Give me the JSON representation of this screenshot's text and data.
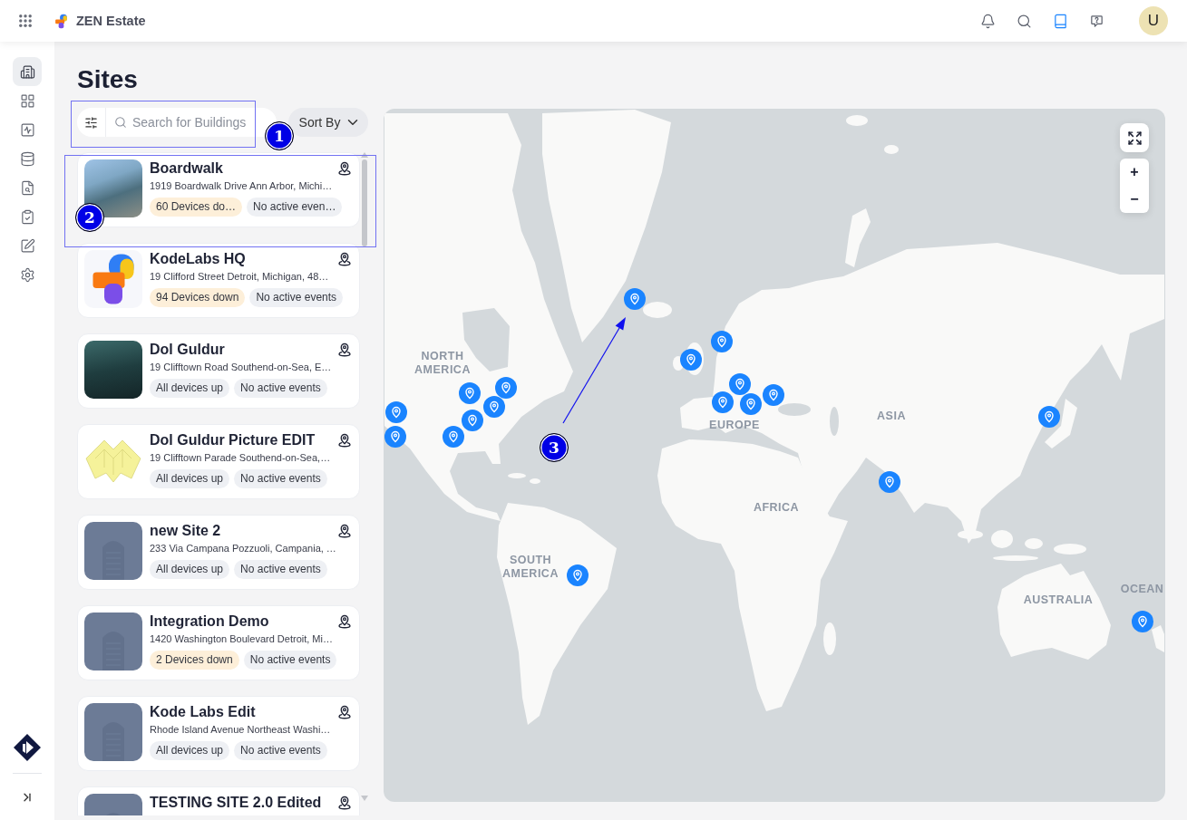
{
  "top_bar": {
    "brand": "ZEN Estate",
    "actions": [
      {
        "kind": "notifications",
        "selected": false
      },
      {
        "kind": "search",
        "selected": false
      },
      {
        "kind": "docs",
        "selected": true
      },
      {
        "kind": "help",
        "selected": false
      }
    ],
    "avatar": "U"
  },
  "nav": {
    "items": [
      {
        "kind": "buildings",
        "selected": true
      },
      {
        "kind": "apps",
        "selected": false
      },
      {
        "kind": "analytics",
        "selected": false
      },
      {
        "kind": "data",
        "selected": false
      },
      {
        "kind": "insights",
        "selected": false
      },
      {
        "kind": "tasks",
        "selected": false
      },
      {
        "kind": "edit",
        "selected": false
      },
      {
        "kind": "settings",
        "selected": false
      }
    ]
  },
  "page": {
    "title": "Sites"
  },
  "toolbar": {
    "search": {
      "placeholder": "Search for Buildings"
    },
    "sort": {
      "label": "Sort By"
    }
  },
  "sites": [
    {
      "kind": "photo",
      "name": "Boardwalk",
      "address": "1919 Boardwalk Drive Ann Arbor, Michi…",
      "devices": "60 Devices do…",
      "devices_down": true,
      "events": "No active even…"
    },
    {
      "kind": "logo",
      "name": "KodeLabs HQ",
      "address": "19 Clifford Street Detroit, Michigan, 48…",
      "devices": "94 Devices down",
      "devices_down": true,
      "events": "No active events"
    },
    {
      "kind": "dark-photo",
      "name": "Dol Guldur",
      "address": "19 Clifftown Road Southend-on-Sea, E…",
      "devices": "All devices up",
      "devices_down": false,
      "events": "No active events"
    },
    {
      "kind": "floor-plan",
      "name": "Dol Guldur Picture EDIT",
      "address": "19 Clifftown Parade Southend-on-Sea,…",
      "devices": "All devices up",
      "devices_down": false,
      "events": "No active events"
    },
    {
      "kind": "placeholder",
      "name": "new Site 2",
      "address": "233 Via Campana Pozzuoli, Campania, …",
      "devices": "All devices up",
      "devices_down": false,
      "events": "No active events"
    },
    {
      "kind": "placeholder",
      "name": "Integration Demo",
      "address": "1420 Washington Boulevard Detroit, Mi…",
      "devices": "2 Devices down",
      "devices_down": true,
      "events": "No active events"
    },
    {
      "kind": "placeholder",
      "name": "Kode Labs Edit",
      "address": "Rhode Island Avenue Northeast Washi…",
      "devices": "All devices up",
      "devices_down": false,
      "events": "No active events"
    },
    {
      "kind": "placeholder",
      "name": "TESTING SITE 2.0 Edited"
    }
  ],
  "map": {
    "labels": [
      "NORTH AMERICA",
      "EUROPE",
      "ASIA",
      "AFRICA",
      "SOUTH AMERICA",
      "AUSTRALIA",
      "OCEAN"
    ],
    "zoom_in": "+",
    "zoom_out": "−"
  },
  "annotations": [
    {
      "kind": "box",
      "label": "1"
    },
    {
      "kind": "box",
      "label": "2"
    },
    {
      "kind": "arrow",
      "label": "3"
    }
  ]
}
